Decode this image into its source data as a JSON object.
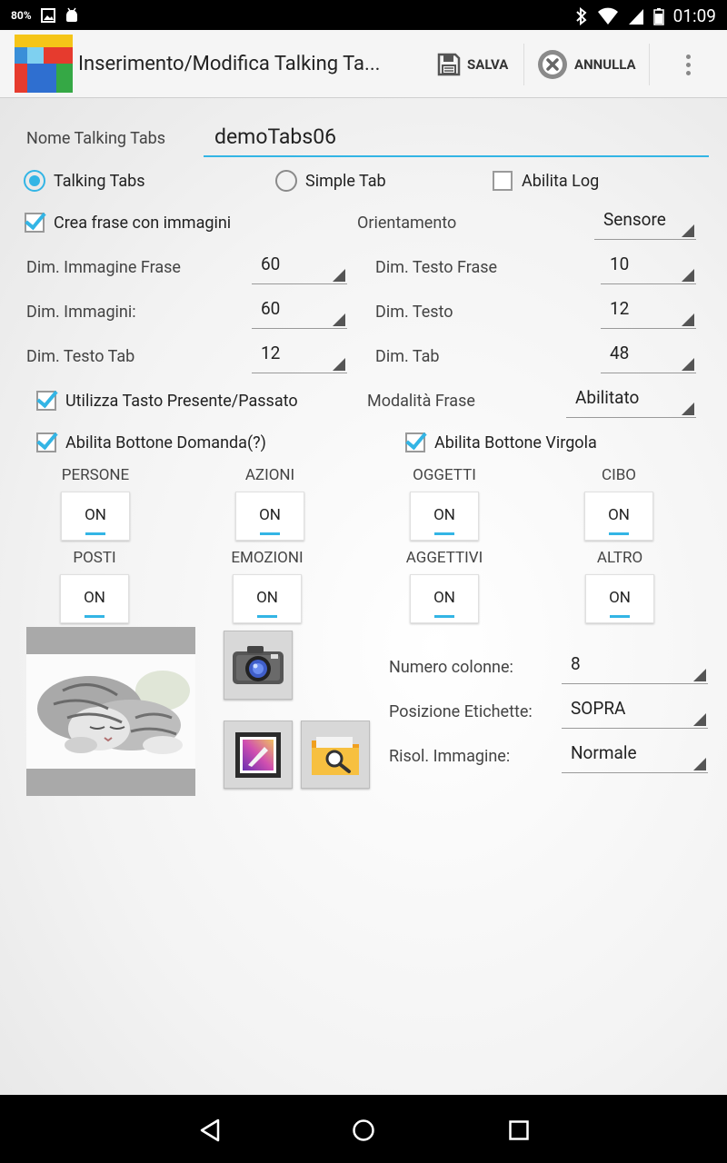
{
  "status_bar": {
    "battery": "80%",
    "time": "01:09"
  },
  "action_bar": {
    "title": "Inserimento/Modifica Talking Ta...",
    "save_label": "SALVA",
    "cancel_label": "ANNULLA"
  },
  "form": {
    "name_label": "Nome Talking Tabs",
    "name_value": "demoTabs06",
    "mode_options": [
      {
        "label": "Talking Tabs",
        "checked": true
      },
      {
        "label": "Simple Tab",
        "checked": false
      }
    ],
    "log": {
      "label": "Abilita Log",
      "checked": false
    },
    "create_phrase": {
      "label": "Crea frase con immagini",
      "checked": true
    },
    "orientation": {
      "label": "Orientamento",
      "value": "Sensore"
    },
    "dim_rows": [
      {
        "left_label": "Dim. Immagine Frase",
        "left_value": "60",
        "right_label": "Dim. Testo Frase",
        "right_value": "10"
      },
      {
        "left_label": "Dim. Immagini:",
        "left_value": "60",
        "right_label": "Dim. Testo",
        "right_value": "12"
      },
      {
        "left_label": "Dim. Testo Tab",
        "left_value": "12",
        "right_label": "Dim. Tab",
        "right_value": "48"
      }
    ],
    "use_tense_key": {
      "label": "Utilizza Tasto Presente/Passato",
      "checked": true
    },
    "phrase_mode": {
      "label": "Modalità Frase",
      "value": "Abilitato"
    },
    "question_button": {
      "label": "Abilita Bottone Domanda(?)",
      "checked": true
    },
    "comma_button": {
      "label": "Abilita Bottone Virgola",
      "checked": true
    },
    "categories": [
      {
        "label": "PERSONE",
        "state": "ON"
      },
      {
        "label": "AZIONI",
        "state": "ON"
      },
      {
        "label": "OGGETTI",
        "state": "ON"
      },
      {
        "label": "CIBO",
        "state": "ON"
      },
      {
        "label": "POSTI",
        "state": "ON"
      },
      {
        "label": "EMOZIONI",
        "state": "ON"
      },
      {
        "label": "AGGETTIVI",
        "state": "ON"
      },
      {
        "label": "ALTRO",
        "state": "ON"
      }
    ],
    "columns": {
      "label": "Numero colonne:",
      "value": "8"
    },
    "label_position": {
      "label": "Posizione Etichette:",
      "value": "SOPRA"
    },
    "image_resolution": {
      "label": "Risol. Immagine:",
      "value": "Normale"
    }
  },
  "colors": {
    "accent": "#33b5e5",
    "background": "#f3f3f3"
  }
}
